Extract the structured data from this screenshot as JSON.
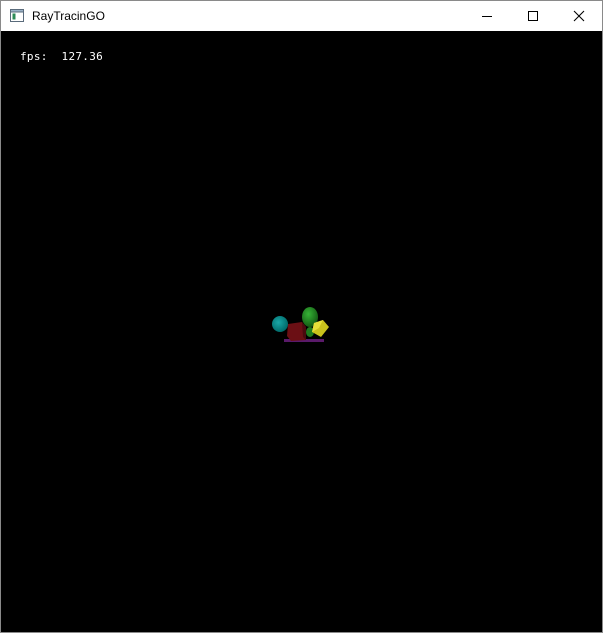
{
  "window": {
    "title": "RayTracinGO",
    "icons": [
      "app-icon",
      "minimize-icon",
      "maximize-icon",
      "close-icon"
    ]
  },
  "hud": {
    "fps_text": "fps:  127.36"
  },
  "scene": {
    "background_color": "#000000",
    "objects": [
      {
        "name": "teal-sphere",
        "color": "#008b8b"
      },
      {
        "name": "dark-red-cube",
        "color": "#6b0f14"
      },
      {
        "name": "green-sphere",
        "color": "#1f8a1f"
      },
      {
        "name": "yellow-cube",
        "color": "#c9c21c"
      },
      {
        "name": "purple-plane",
        "color": "#5a1a6a"
      }
    ]
  }
}
